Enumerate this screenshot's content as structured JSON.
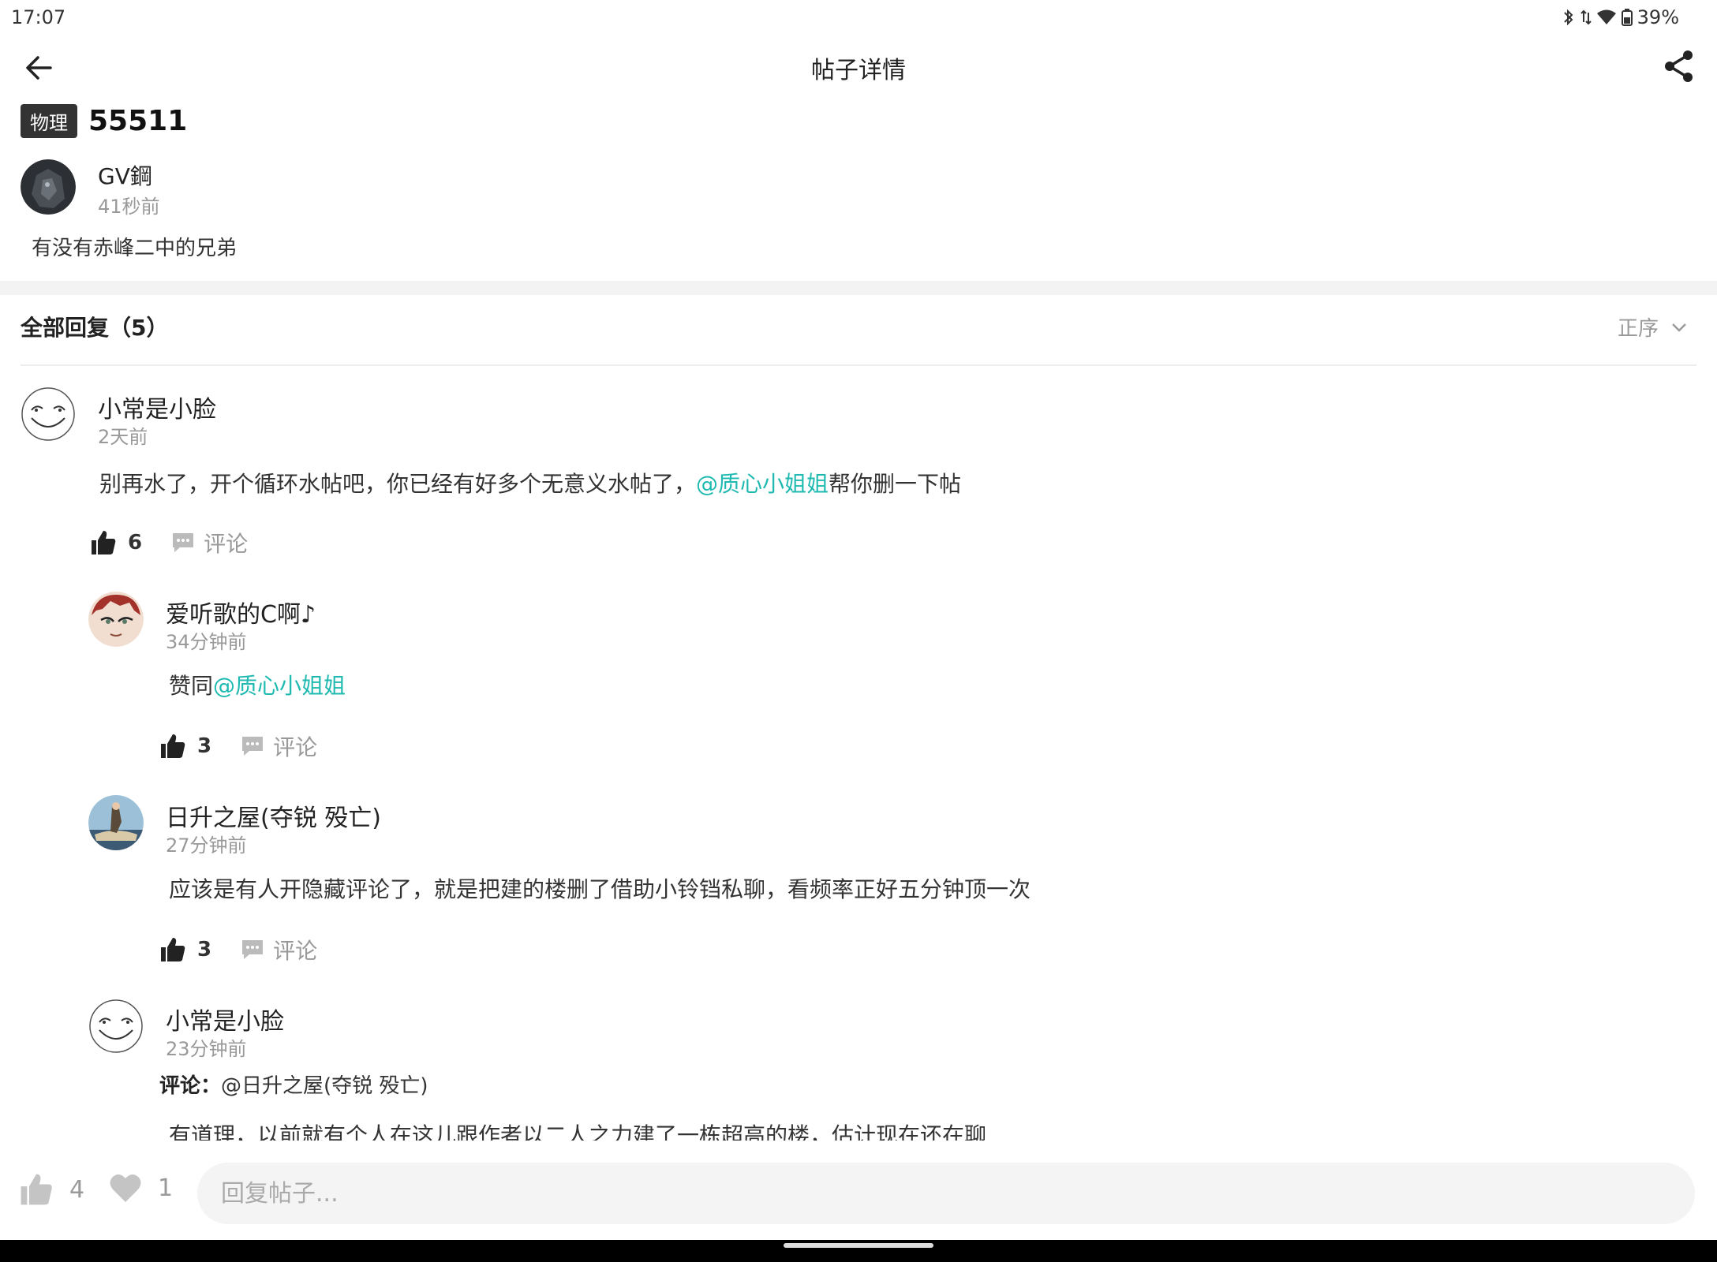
{
  "status_bar": {
    "time": "17:07",
    "battery": "39%"
  },
  "topbar": {
    "title": "帖子详情"
  },
  "post": {
    "tag": "物理",
    "title": "55511",
    "author": {
      "name": "GV鋼",
      "time": "41秒前"
    },
    "body": "有没有赤峰二中的兄弟"
  },
  "replies": {
    "header": "全部回复（5）",
    "sort_label": "正序",
    "items": [
      {
        "name": "小常是小脸",
        "time": "2天前",
        "text_before": "别再水了，开个循环水帖吧，你已经有好多个无意义水帖了，",
        "mention": "@质心小姐姐",
        "text_after": "帮你删一下帖",
        "likes": "6",
        "comment_label": "评论"
      },
      {
        "name": "爱听歌的C啊♪",
        "time": "34分钟前",
        "text_before": "赞同",
        "mention": "@质心小姐姐",
        "likes": "3",
        "comment_label": "评论"
      },
      {
        "name": "日升之屋(夺锐 殁亡)",
        "time": "27分钟前",
        "text": "应该是有人开隐藏评论了，就是把建的楼删了借助小铃铛私聊，看频率正好五分钟顶一次",
        "likes": "3",
        "comment_label": "评论"
      },
      {
        "name": "小常是小脸",
        "time": "23分钟前",
        "reply_label": "评论：",
        "reply_target": "@日升之屋(夺锐 殁亡)",
        "text": "有道理，以前就有个人在这儿跟作者以二人之力建了一栋超高的楼，估计现在还在聊"
      }
    ]
  },
  "bottom_bar": {
    "like_count": "4",
    "favorite_count": "1",
    "reply_placeholder": "回复帖子..."
  },
  "colors": {
    "mention": "#1ebab2",
    "tag_bg": "#333333"
  }
}
